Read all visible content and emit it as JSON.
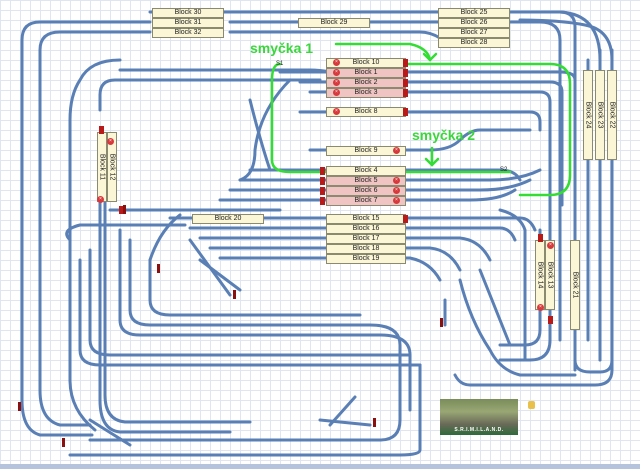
{
  "blocks": {
    "b30": "Block 30",
    "b31": "Block 31",
    "b32": "Block 32",
    "b29": "Block 29",
    "b25": "Block 25",
    "b26": "Block 26",
    "b27": "Block 27",
    "b28": "Block 28",
    "b10": "Block 10",
    "b1": "Block 1",
    "b2": "Block 2",
    "b3": "Block 3",
    "b8": "Block 8",
    "b9": "Block 9",
    "b4": "Block 4",
    "b5": "Block 5",
    "b6": "Block 6",
    "b7": "Block 7",
    "b15": "Block 15",
    "b16": "Block 16",
    "b17": "Block 17",
    "b18": "Block 18",
    "b19": "Block 19",
    "b20": "Block 20",
    "b11": "Block 11",
    "b12": "Block 12",
    "b13": "Block 13",
    "b14": "Block 14",
    "b21": "Block 21",
    "b22": "Block 22",
    "b23": "Block 23",
    "b24": "Block 24"
  },
  "loops": {
    "loop1": "smyčka 1",
    "loop2": "smyčka 2"
  },
  "sections": {
    "s1": "S1",
    "s2": "S2"
  },
  "logo": {
    "text": "S.R.I.M.I.L.A.N.D."
  },
  "colors": {
    "track": "#5a7fb5",
    "track_fill": "#c8d6ea",
    "loop_highlight": "#33dd33",
    "occupied": "#f1c4c4",
    "block": "#fbf6d6",
    "signal": "#b81a1a"
  }
}
